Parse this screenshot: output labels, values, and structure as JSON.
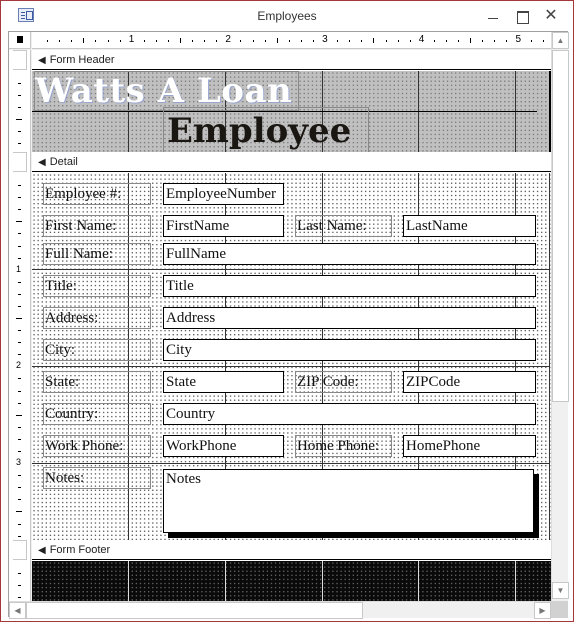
{
  "window": {
    "title": "Employees",
    "icon": "form-icon",
    "controls": {
      "minimize": "minimize-icon",
      "maximize": "maximize-icon",
      "close": "✕"
    }
  },
  "ruler": {
    "horizontal_labels": [
      "1",
      "2",
      "3",
      "4",
      "5"
    ],
    "vertical_labels": [
      "1",
      "2",
      "3"
    ]
  },
  "sections": {
    "form_header": {
      "label": "Form Header",
      "icon": "section-arrow-icon"
    },
    "detail": {
      "label": "Detail",
      "icon": "section-arrow-icon"
    },
    "form_footer": {
      "label": "Form Footer",
      "icon": "section-arrow-icon"
    }
  },
  "header": {
    "company_title": "Watts A Loan",
    "form_title": "Employee"
  },
  "detail": {
    "fields": [
      {
        "label": "Employee #:",
        "control": "EmployeeNumber"
      },
      {
        "label": "First Name:",
        "control": "FirstName"
      },
      {
        "label": "Last Name:",
        "control": "LastName"
      },
      {
        "label": "Full Name:",
        "control": "FullName"
      },
      {
        "label": "Title:",
        "control": "Title"
      },
      {
        "label": "Address:",
        "control": "Address"
      },
      {
        "label": "City:",
        "control": "City"
      },
      {
        "label": "State:",
        "control": "State"
      },
      {
        "label": "ZIP Code:",
        "control": "ZIPCode"
      },
      {
        "label": "Country:",
        "control": "Country"
      },
      {
        "label": "Work Phone:",
        "control": "WorkPhone"
      },
      {
        "label": "Home Phone:",
        "control": "HomePhone"
      },
      {
        "label": "Notes:",
        "control": "Notes"
      }
    ]
  },
  "scrollbars": {
    "up": "▲",
    "down": "▼",
    "left": "◀",
    "right": "▶"
  },
  "colors": {
    "window_border": "#a4373a",
    "header_background": "#c0c0c0",
    "footer_background": "#0a0a0a",
    "header_title_color": "#ffffff",
    "form_title_color": "#1a1612"
  }
}
